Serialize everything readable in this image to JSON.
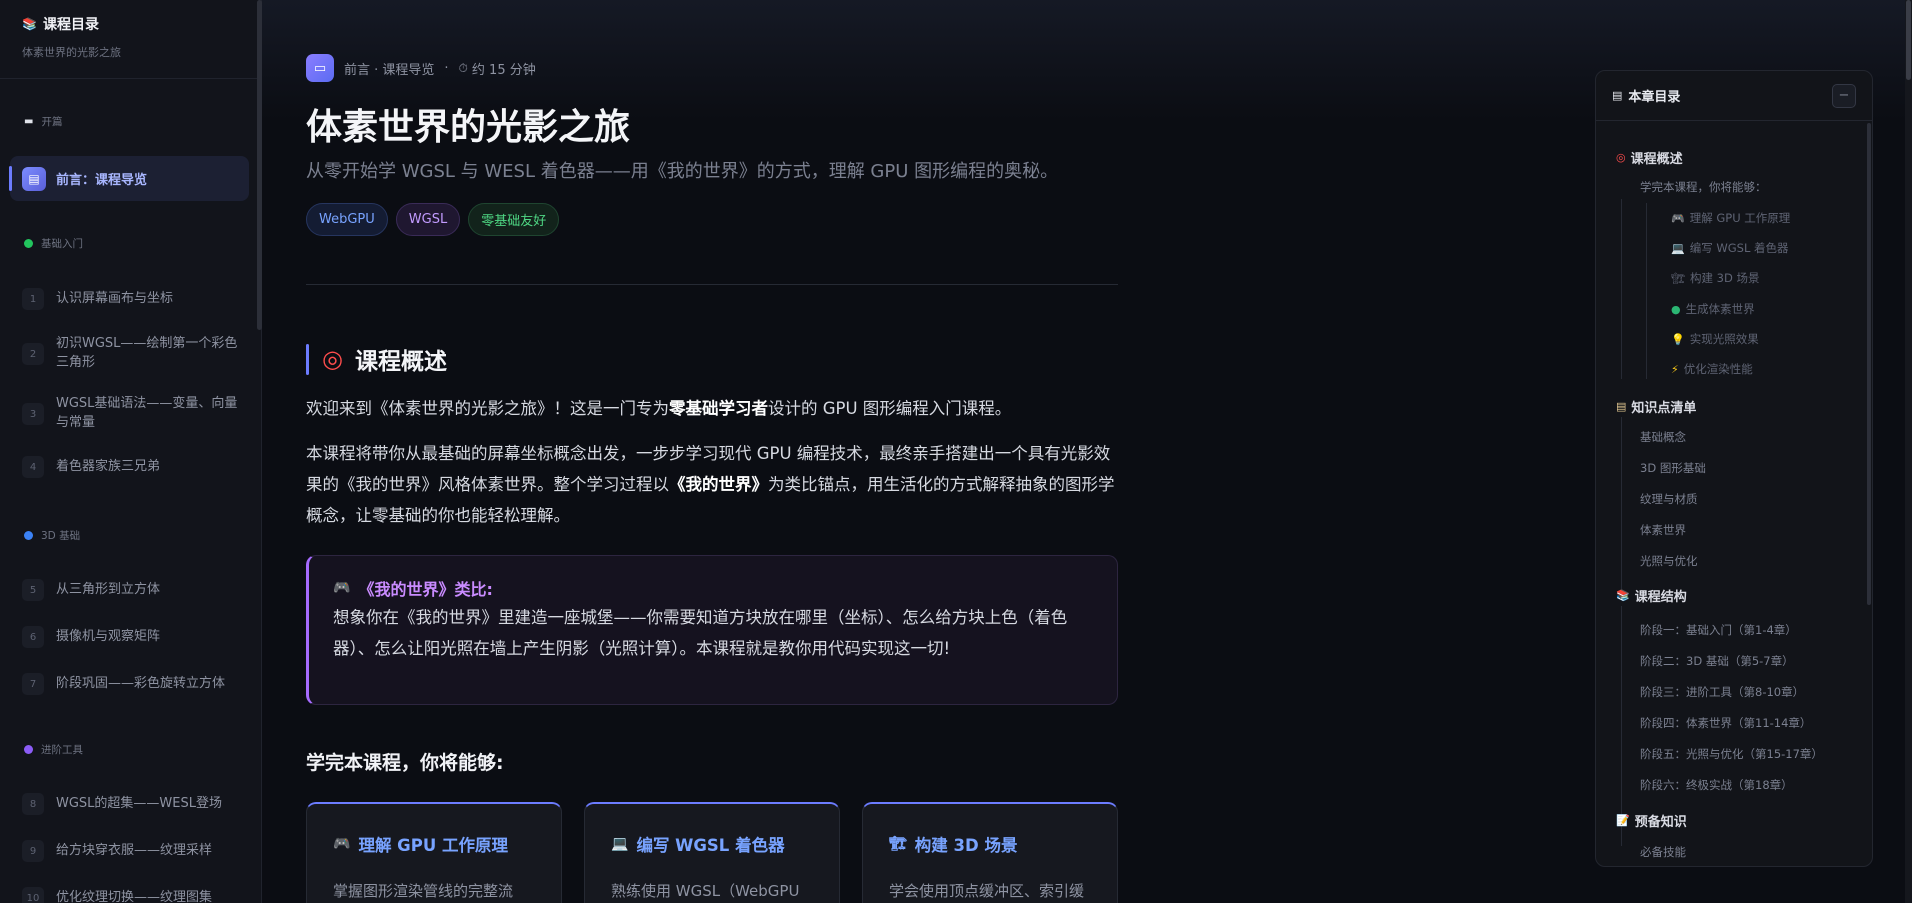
{
  "sidebar": {
    "title": "课程目录",
    "subtitle": "体素世界的光影之旅",
    "groups": [
      {
        "label": "开篇",
        "color": "#e0e3ea"
      },
      {
        "label": "基础入门",
        "color": "#22c55e"
      },
      {
        "label": "3D 基础",
        "color": "#3b82f6"
      },
      {
        "label": "进阶工具",
        "color": "#8b5cf6"
      }
    ],
    "active_item": {
      "label": "前言：课程导览",
      "icon": "book-icon"
    },
    "items": [
      {
        "num": "1",
        "label": "认识屏幕画布与坐标"
      },
      {
        "num": "2",
        "label": "初识WGSL——绘制第一个彩色三角形"
      },
      {
        "num": "3",
        "label": "WGSL基础语法——变量、向量与常量"
      },
      {
        "num": "4",
        "label": "着色器家族三兄弟"
      },
      {
        "num": "5",
        "label": "从三角形到立方体"
      },
      {
        "num": "6",
        "label": "摄像机与观察矩阵"
      },
      {
        "num": "7",
        "label": "阶段巩固——彩色旋转立方体"
      },
      {
        "num": "8",
        "label": "WGSL的超集——WESL登场"
      },
      {
        "num": "9",
        "label": "给方块穿衣服——纹理采样"
      },
      {
        "num": "10",
        "label": "优化纹理切换——纹理图集"
      }
    ]
  },
  "main": {
    "breadcrumb": "前言 · 课程导览",
    "separator": "·",
    "read_time": "约 15 分钟",
    "title": "体素世界的光影之旅",
    "subtitle": "从零开始学 WGSL 与 WESL 着色器——用《我的世界》的方式，理解 GPU 图形编程的奥秘。",
    "tags": [
      "WebGPU",
      "WGSL",
      "零基础友好"
    ],
    "section_title": "课程概述",
    "p1_before": "欢迎来到《体素世界的光影之旅》！这是一门专为",
    "p1_bold": "零基础学习者",
    "p1_after": "设计的 GPU 图形编程入门课程。",
    "p2_before": "本课程将带你从最基础的屏幕坐标概念出发，一步步学习现代 GPU 编程技术，最终亲手搭建出一个具有光影效果的《我的世界》风格体素世界。整个学习过程以",
    "p2_bold": "《我的世界》",
    "p2_after": "为类比锚点，用生活化的方式解释抽象的图形学概念，让零基础的你也能轻松理解。",
    "callout_title": "《我的世界》类比:",
    "callout_body": "想象你在《我的世界》里建造一座城堡——你需要知道方块放在哪里（坐标）、怎么给方块上色（着色器）、怎么让阳光照在墙上产生阴影（光照计算）。本课程就是教你用代码实现这一切!",
    "learn_title": "学完本课程，你将能够:",
    "cards": [
      {
        "icon": "🎮",
        "title": "理解 GPU 工作原理",
        "desc": "掌握图形渲染管线的完整流"
      },
      {
        "icon": "💻",
        "title": "编写 WGSL 着色器",
        "desc": "熟练使用 WGSL（WebGPU"
      },
      {
        "icon": "🏗",
        "title": "构建 3D 场景",
        "desc": "学会使用顶点缓冲区、索引缓"
      }
    ]
  },
  "toc": {
    "title": "本章目录",
    "collapse_label": "−",
    "sections": [
      {
        "title": "课程概述",
        "icon": "target-icon"
      },
      {
        "title": "知识点清单",
        "icon": "clipboard-icon"
      },
      {
        "title": "课程结构",
        "icon": "books-icon"
      },
      {
        "title": "预备知识",
        "icon": "memo-icon"
      }
    ],
    "overview_sub": "学完本课程，你将能够：",
    "overview_items": [
      {
        "icon": "🎮",
        "label": "理解 GPU 工作原理"
      },
      {
        "icon": "💻",
        "label": "编写 WGSL 着色器"
      },
      {
        "icon": "🏗",
        "label": "构建 3D 场景"
      },
      {
        "icon": "●",
        "label": "生成体素世界"
      },
      {
        "icon": "💡",
        "label": "实现光照效果"
      },
      {
        "icon": "⚡",
        "label": "优化渲染性能"
      }
    ],
    "knowledge_items": [
      "基础概念",
      "3D 图形基础",
      "纹理与材质",
      "体素世界",
      "光照与优化"
    ],
    "structure_items": [
      "阶段一：基础入门（第1-4章）",
      "阶段二：3D 基础（第5-7章）",
      "阶段三：进阶工具（第8-10章）",
      "阶段四：体素世界（第11-14章）",
      "阶段五：光照与优化（第15-17章）",
      "阶段六：终极实战（第18章）"
    ],
    "prereq_items": [
      "必备技能"
    ]
  }
}
